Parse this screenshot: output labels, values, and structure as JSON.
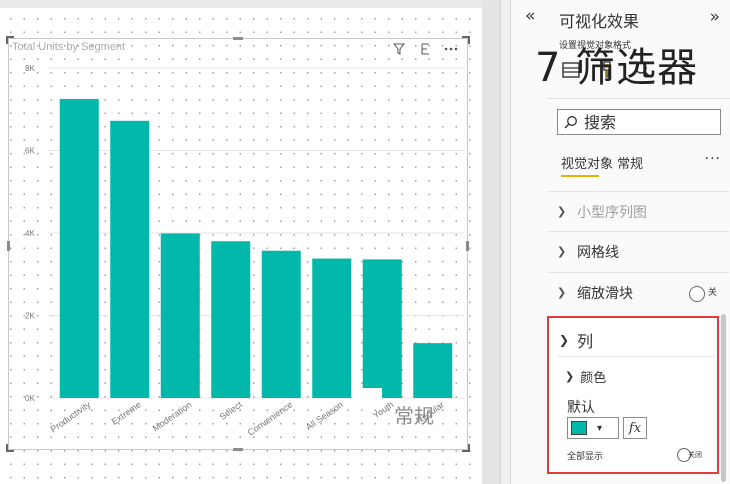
{
  "canvas": {
    "chart_title": "Total Units by Segment",
    "general_overlay": "常规"
  },
  "pane": {
    "title": "可视化效果",
    "subtitle": "设置视觉对象格式",
    "filter_overlay": "7 筛选器",
    "search_placeholder": "搜索",
    "tab_label": "视觉对象 常规",
    "more_label": "···",
    "sections": {
      "small_multiples": "小型序列图",
      "gridlines": "网格线",
      "zoom_slider": "缩放滑块",
      "zoom_toggle_label": "关"
    },
    "column_section": {
      "title": "列",
      "color": {
        "title": "颜色",
        "default_label": "默认",
        "swatch_color": "#01B8AA",
        "fx_label": "fx",
        "show_all_label": "全部显示",
        "show_all_toggle_label": "关闭"
      }
    }
  },
  "chart_data": {
    "type": "bar",
    "title": "Total Units by Segment",
    "categories": [
      "Productivity",
      "Extreme",
      "Moderation",
      "Select",
      "Convenience",
      "All Season",
      "Youth",
      "Regular"
    ],
    "values": [
      7250,
      6720,
      3990,
      3800,
      3570,
      3380,
      3360,
      1330
    ],
    "yticks": [
      {
        "value": 0,
        "label": "0K"
      },
      {
        "value": 2000,
        "label": "2K"
      },
      {
        "value": 4000,
        "label": "4K"
      },
      {
        "value": 6000,
        "label": "6K"
      },
      {
        "value": 8000,
        "label": "8K"
      }
    ],
    "ylim": [
      0,
      8000
    ],
    "bar_color": "#01B8AA",
    "grid": true
  }
}
